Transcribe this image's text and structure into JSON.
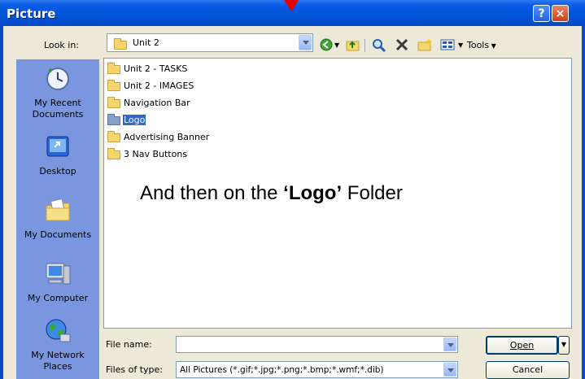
{
  "window": {
    "title": "Picture",
    "help_label": "?",
    "close_label": "×"
  },
  "look_in": {
    "label": "Look in:",
    "value": "Unit 2"
  },
  "toolbar": {
    "tools_label": "Tools"
  },
  "places": [
    {
      "label": "My Recent Documents",
      "icon": "recent-documents-icon"
    },
    {
      "label": "Desktop",
      "icon": "desktop-icon"
    },
    {
      "label": "My Documents",
      "icon": "my-documents-icon"
    },
    {
      "label": "My Computer",
      "icon": "my-computer-icon"
    },
    {
      "label": "My Network Places",
      "icon": "network-places-icon"
    }
  ],
  "folders": [
    {
      "name": "Unit 2 - TASKS",
      "selected": false
    },
    {
      "name": "Unit 2 - IMAGES",
      "selected": false
    },
    {
      "name": "Navigation Bar",
      "selected": false
    },
    {
      "name": "Logo",
      "selected": true
    },
    {
      "name": "Advertising Banner",
      "selected": false
    },
    {
      "name": "3 Nav Buttons",
      "selected": false
    }
  ],
  "instruction": {
    "prefix": "And then on the ",
    "highlight": "‘Logo’",
    "suffix": " Folder"
  },
  "file_name": {
    "label": "File name:",
    "value": ""
  },
  "file_type": {
    "label": "Files of type:",
    "value": "All Pictures (*.gif;*.jpg;*.png;*.bmp;*.wmf;*.dib)"
  },
  "buttons": {
    "open": "Open",
    "cancel": "Cancel"
  },
  "colors": {
    "title_bar": "#0a5ae4",
    "selection": "#316ac5",
    "places_bar": "#7a96df",
    "arrow": "#e30000"
  }
}
